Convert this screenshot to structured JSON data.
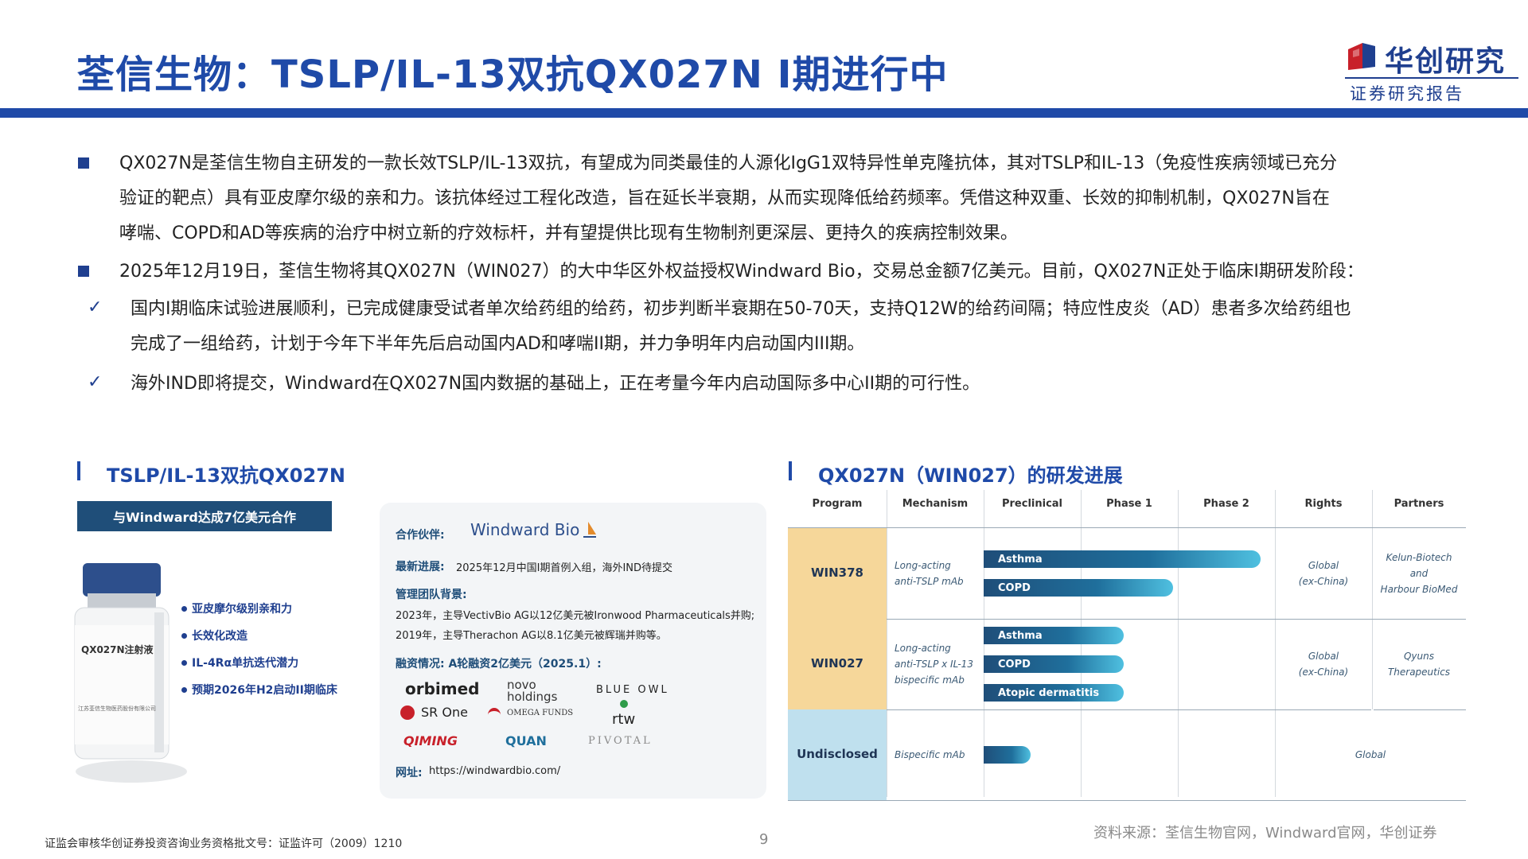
{
  "header": {
    "title": "荃信生物：TSLP/IL-13双抗QX027N I期进行中",
    "logo_name": "华创研究",
    "logo_sub": "证券研究报告"
  },
  "body": {
    "p1_lines": [
      "QX027N是荃信生物自主研发的一款长效TSLP/IL-13双抗，有望成为同类最佳的人源化IgG1双特异性单克隆抗体，其对TSLP和IL-13（免疫性疾病领域已充分",
      "验证的靶点）具有亚皮摩尔级的亲和力。该抗体经过工程化改造，旨在延长半衰期，从而实现降低给药频率。凭借这种双重、长效的抑制机制，QX027N旨在",
      "哮喘、COPD和AD等疾病的治疗中树立新的疗效标杆，并有望提供比现有生物制剂更深层、更持久的疾病控制效果。"
    ],
    "p2": "2025年12月19日，荃信生物将其QX027N（WIN027）的大中华区外权益授权Windward Bio，交易总金额7亿美元。目前，QX027N正处于临床I期研发阶段：",
    "c1_lines": [
      "国内I期临床试验进展顺利，已完成健康受试者单次给药组的给药，初步判断半衰期在50-70天，支持Q12W的给药间隔；特应性皮炎（AD）患者多次给药组也",
      "完成了一组给药，计划于今年下半年先后启动国内AD和哮喘II期，并力争明年内启动国内III期。"
    ],
    "c2": "海外IND即将提交，Windward在QX027N国内数据的基础上，正在考量今年内启动国际多中心II期的可行性。",
    "check_mark": "✓"
  },
  "left_section": {
    "title": "TSLP/IL-13双抗QX027N",
    "banner": "与Windward达成7亿美元合作",
    "vial_label": "QX027N注射液",
    "vial_maker": "江苏荃信生物医药股份有限公司",
    "features": [
      "亚皮摩尔级别亲和力",
      "长效化改造",
      "IL-4Rα单抗迭代潜力",
      "预期2026年H2启动II期临床"
    ]
  },
  "card": {
    "partner_label": "合作伙伴:",
    "partner_name": "Windward Bio",
    "progress_label": "最新进展:",
    "progress_text": "2025年12月中国I期首例入组，海外IND待提交",
    "team_label": "管理团队背景:",
    "team_line1": "2023年，主导VectivBio AG以12亿美元被Ironwood Pharmaceuticals并购;",
    "team_line2": "2019年，主导Therachon AG以8.1亿美元被辉瑞并购等。",
    "funding_label": "融资情况: A轮融资2亿美元（2025.1）:",
    "investors": [
      "orbimed",
      "novo holdings",
      "BLUE OWL",
      "SR One",
      "OMEGA FUNDS",
      "rtw",
      "QIMING",
      "QUAN",
      "PIVOTAL"
    ],
    "website_label": "网址:",
    "website": "https://windwardbio.com/"
  },
  "right_section": {
    "title": "QX027N（WIN027）的研发进展"
  },
  "pipeline": {
    "columns": [
      "Program",
      "Mechanism",
      "Preclinical",
      "Phase 1",
      "Phase 2",
      "Rights",
      "Partners"
    ],
    "programs": [
      {
        "name": "WIN378",
        "color": "#f6d79a",
        "mechanism": [
          "Long-acting",
          "anti-TSLP mAb"
        ],
        "bars": [
          {
            "label": "Asthma",
            "progress": 0.95
          },
          {
            "label": "COPD",
            "progress": 0.65
          }
        ],
        "rights": [
          "Global",
          "(ex-China)"
        ],
        "partners": [
          "Kelun-Biotech",
          "and",
          "Harbour BioMed"
        ]
      },
      {
        "name": "WIN027",
        "color": "#f6d79a",
        "mechanism": [
          "Long-acting",
          "anti-TSLP x IL-13",
          "bispecific mAb"
        ],
        "bars": [
          {
            "label": "Asthma",
            "progress": 0.48
          },
          {
            "label": "COPD",
            "progress": 0.48
          },
          {
            "label": "Atopic dermatitis",
            "progress": 0.48
          }
        ],
        "rights": [
          "Global",
          "(ex-China)"
        ],
        "partners": [
          "Qyuns",
          "Therapeutics"
        ]
      },
      {
        "name": "Undisclosed",
        "color": "#bfe0ee",
        "mechanism": [
          "Bispecific mAb"
        ],
        "bars": [
          {
            "label": "",
            "progress": 0.16
          }
        ],
        "rights": [
          "Global"
        ],
        "partners": []
      }
    ]
  },
  "footer": {
    "license": "证监会审核华创证券投资咨询业务资格批文号：证监许可（2009）1210",
    "page": "9",
    "source": "资料来源：荃信生物官网，Windward官网，华创证券"
  }
}
